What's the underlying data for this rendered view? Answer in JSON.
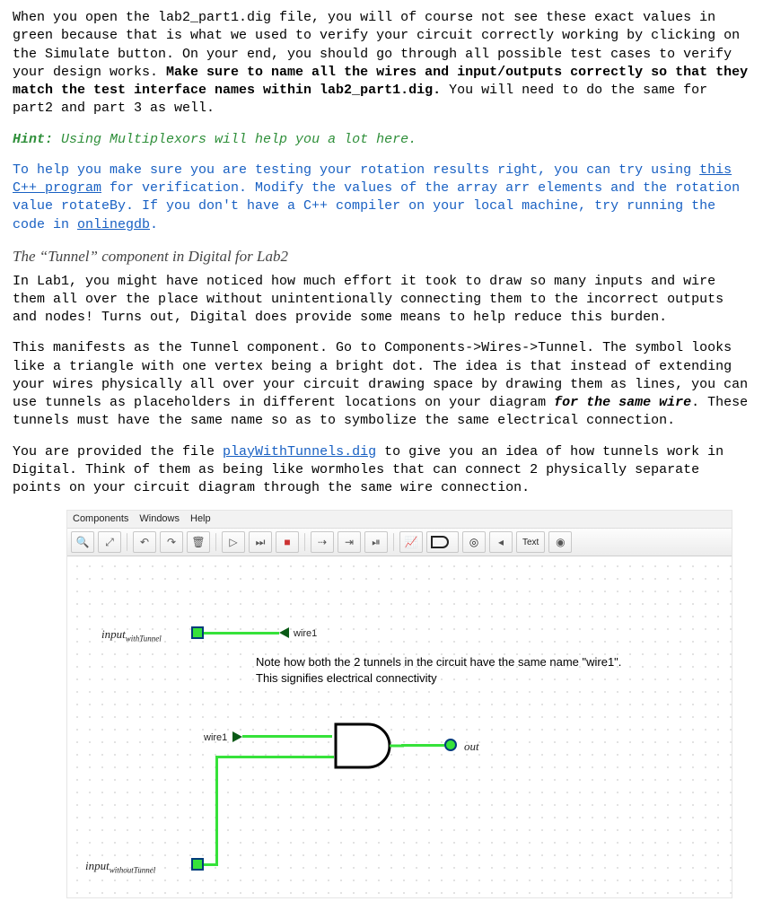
{
  "para1": {
    "a": "When you open the lab2_part1.dig file, you will of course not see these exact values in green because that is what we used to verify your circuit correctly working by clicking on the Simulate button. On your end, you should go through all possible test cases to verify your design works. ",
    "bold": "Make sure to name all the wires and input/outputs correctly so that they match the test interface names within lab2_part1.dig.",
    "b": " You will need to do the same for part2 and part 3 as well."
  },
  "hint": {
    "label": "Hint:",
    "text": " Using Multiplexors will help you a lot here."
  },
  "para2": {
    "a": "To help you make sure you are testing your rotation results right, you can try using ",
    "link1": "this C++ program",
    "b": " for verification. Modify the values of the array arr elements and the rotation value rotateBy. If you don't have a C++ compiler on your local machine, try running the code in ",
    "link2": "onlinegdb",
    "c": "."
  },
  "heading": "The “Tunnel” component in Digital for Lab2",
  "para3": "In Lab1, you might have noticed how much effort it took to draw so many inputs and wire them all over the place without unintentionally connecting them to the incorrect outputs and nodes! Turns out, Digital does provide some means to help reduce this burden.",
  "para4": {
    "a": "This manifests as the Tunnel component. Go to Components->Wires->Tunnel. The symbol looks like a triangle with one vertex being a bright dot. The idea is that instead of extending your wires physically all over your circuit drawing space by drawing them as lines, you can use tunnels as placeholders in different locations on your diagram ",
    "bold": "for the same wire",
    "b": ". These tunnels must have the same name so as to symbolize the same electrical connection."
  },
  "para5": {
    "a": "You are provided the file ",
    "link1": "playWithTunnels.dig",
    "b": " to give you an idea of how tunnels work in Digital. Think of them as being like wormholes that can connect 2 physically separate points on your circuit diagram through the same wire connection."
  },
  "screenshot": {
    "menus": [
      "Components",
      "Windows",
      "Help"
    ],
    "textbtn": "Text",
    "input1_label": "input",
    "input1_sub": "withTunnel",
    "wire1_a": "wire1",
    "note_line1": "Note how both the 2 tunnels in the circuit have the same name \"wire1\".",
    "note_line2": "This signifies electrical connectivity",
    "wire1_b": "wire1",
    "out_label": "out",
    "input2_label": "input",
    "input2_sub": "withoutTunnel"
  }
}
